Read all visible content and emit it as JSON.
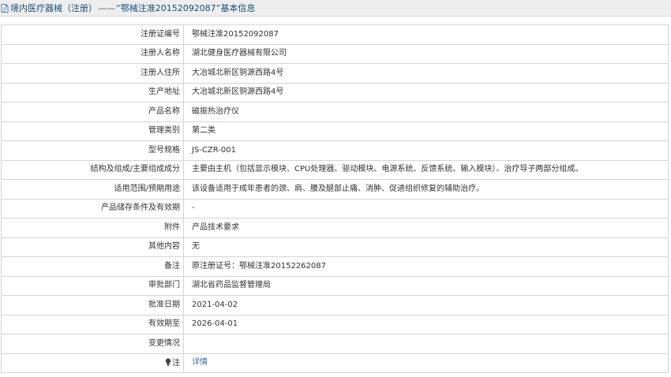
{
  "header": {
    "category": "境内医疗器械（注册）",
    "separator": "——",
    "subject": "“鄂械注准20152092087”基本信息"
  },
  "rows": [
    {
      "label": "注册证编号",
      "value": "鄂械注准20152092087"
    },
    {
      "label": "注册人名称",
      "value": "湖北健身医疗器械有限公司"
    },
    {
      "label": "注册人住所",
      "value": "大冶城北新区铜源西路4号"
    },
    {
      "label": "生产地址",
      "value": "大冶城北新区铜源西路4号"
    },
    {
      "label": "产品名称",
      "value": "磁振热治疗仪"
    },
    {
      "label": "管理类别",
      "value": "第二类"
    },
    {
      "label": "型号规格",
      "value": "JS-CZR-001"
    },
    {
      "label": "结构及组成/主要组成成分",
      "value": "主要由主机（包括显示模块、CPU处理器、驱动模块、电源系统、反馈系统、输入模块）、治疗导子两部分组成。"
    },
    {
      "label": "适用范围/预期用途",
      "value": "该设备适用于成年患者的颈、肩、腰及腿部止痛、消肿、促进组织修复的辅助治疗。"
    },
    {
      "label": "产品储存条件及有效期",
      "value": "-"
    },
    {
      "label": "附件",
      "value": "产品技术要求"
    },
    {
      "label": "其他内容",
      "value": "无"
    },
    {
      "label": "备注",
      "value": "原注册证号：鄂械注准20152262087"
    },
    {
      "label": "审批部门",
      "value": "湖北省药品监督管理局"
    },
    {
      "label": "批准日期",
      "value": "2021-04-02"
    },
    {
      "label": "有效期至",
      "value": "2026-04-01"
    },
    {
      "label": "变更情况",
      "value": ""
    }
  ],
  "note_row": {
    "icon": "lightbulb-icon",
    "label": "注",
    "link_text": "详情"
  },
  "colors": {
    "title_text": "#1a4e7c",
    "link": "#2e6bb5",
    "border": "#d4d4d4",
    "header_bg": "#eeeeee"
  }
}
